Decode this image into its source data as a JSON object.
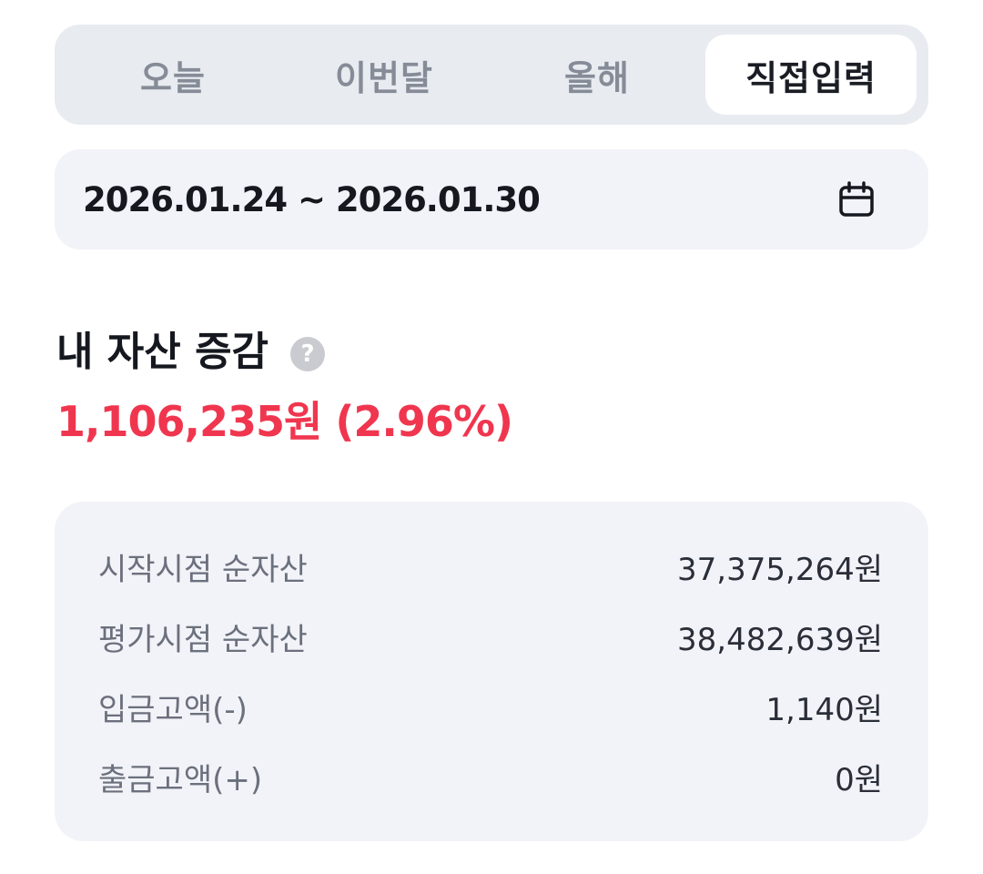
{
  "period_tabs": [
    {
      "label": "오늘",
      "active": false
    },
    {
      "label": "이번달",
      "active": false
    },
    {
      "label": "올해",
      "active": false
    },
    {
      "label": "직접입력",
      "active": true
    }
  ],
  "date_range": {
    "text": "2026.01.24 ~ 2026.01.30",
    "icon": "calendar-icon"
  },
  "asset_change": {
    "title": "내 자산 증감",
    "help_icon": "?",
    "value": "1,106,235원 (2.96%)",
    "color": "#f0364f"
  },
  "summary": {
    "rows": [
      {
        "label": "시작시점 순자산",
        "value": "37,375,264원"
      },
      {
        "label": "평가시점 순자산",
        "value": "38,482,639원"
      },
      {
        "label": "입금고액(-)",
        "value": "1,140원"
      },
      {
        "label": "출금고액(+)",
        "value": "0원"
      }
    ]
  }
}
